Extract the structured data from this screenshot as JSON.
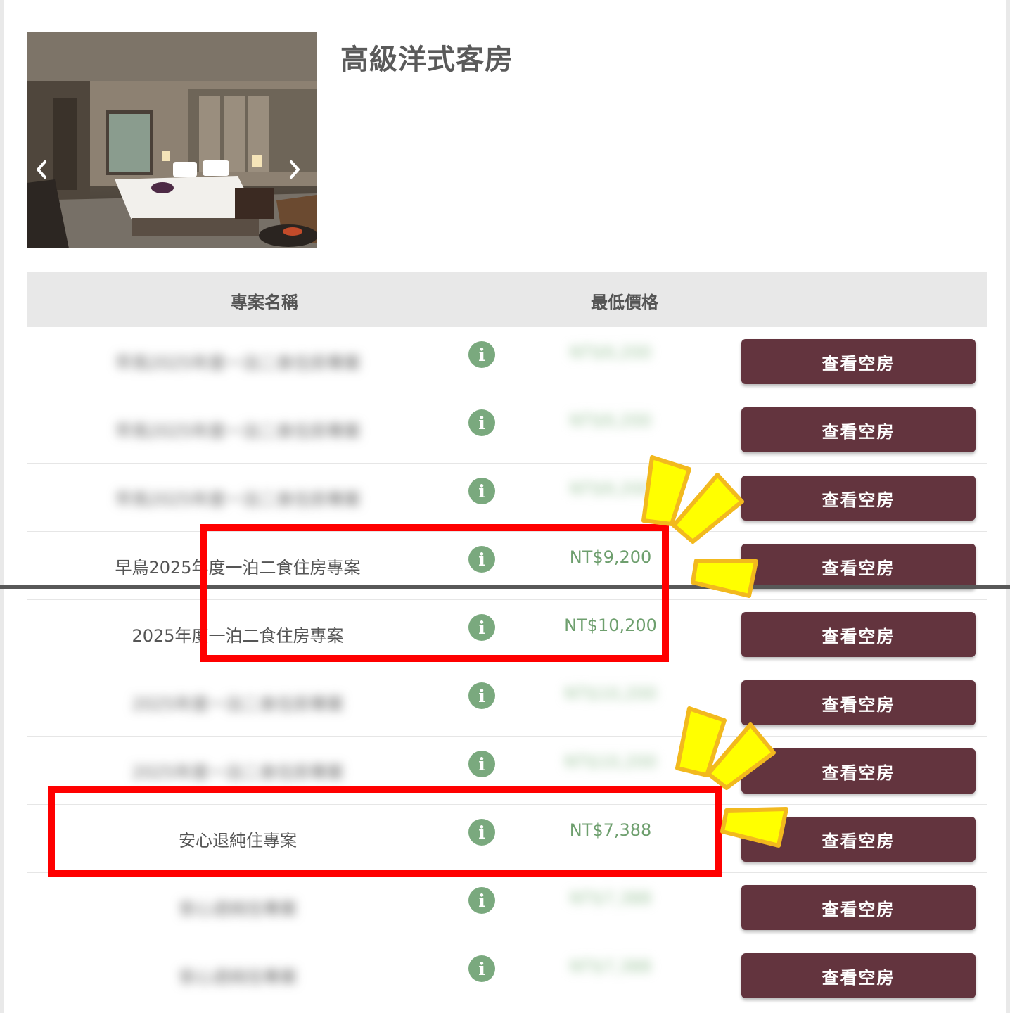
{
  "room": {
    "title": "高級洋式客房",
    "photo_label": "room-photo"
  },
  "table": {
    "headers": {
      "plan_name": "專案名稱",
      "min_price": "最低價格"
    },
    "rows": [
      {
        "plan": "早鳥2025年度一泊二食住房專案",
        "price": "NT$9,200",
        "blurred": true,
        "button": "查看空房"
      },
      {
        "plan": "早鳥2025年度一泊二食住房專案",
        "price": "NT$9,200",
        "blurred": true,
        "button": "查看空房"
      },
      {
        "plan": "早鳥2025年度一泊二食住房專案",
        "price": "NT$9,200",
        "blurred": true,
        "button": "查看空房"
      },
      {
        "plan": "早鳥2025年度一泊二食住房專案",
        "price": "NT$9,200",
        "blurred": false,
        "button": "查看空房"
      },
      {
        "plan": "2025年度一泊二食住房專案",
        "price": "NT$10,200",
        "blurred": false,
        "button": "查看空房"
      },
      {
        "plan": "2025年度一泊二食住房專案",
        "price": "NT$10,200",
        "blurred": true,
        "button": "查看空房"
      },
      {
        "plan": "2025年度一泊二食住房專案",
        "price": "NT$10,200",
        "blurred": true,
        "button": "查看空房"
      },
      {
        "plan": "安心退純住專案",
        "price": "NT$7,388",
        "blurred": false,
        "button": "查看空房"
      },
      {
        "plan": "安心退純住專案",
        "price": "NT$7,388",
        "blurred": true,
        "button": "查看空房"
      },
      {
        "plan": "安心退純住專案",
        "price": "NT$7,388",
        "blurred": true,
        "button": "查看空房"
      }
    ]
  },
  "colors": {
    "button": "#63343e",
    "price": "#6e9f6e",
    "info_icon": "#7aa97e",
    "highlight": "#ff0000",
    "burst": "#ffff00"
  },
  "icons": [
    "chevron-left-icon",
    "chevron-right-icon",
    "info-icon",
    "carousel-dot"
  ]
}
